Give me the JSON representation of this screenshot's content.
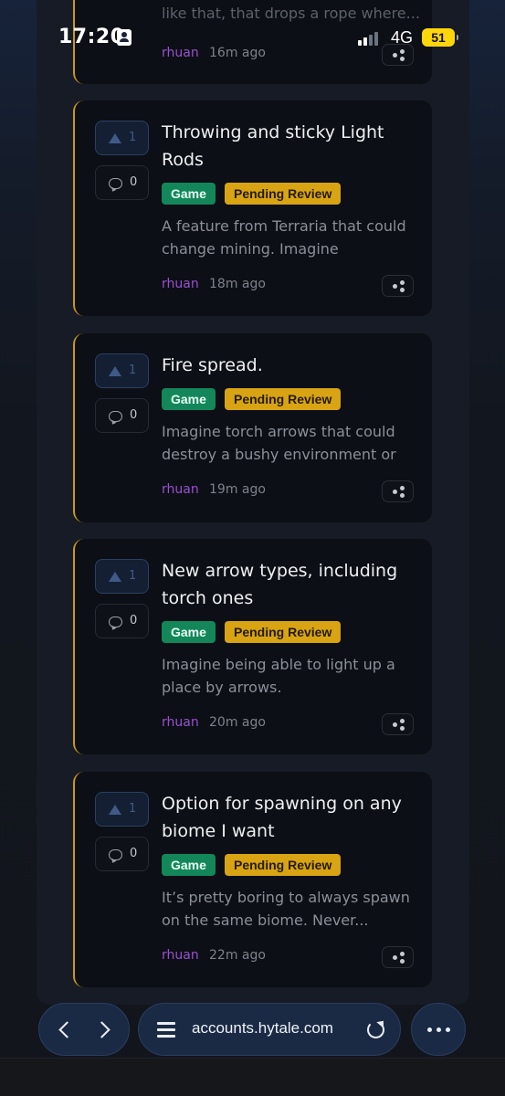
{
  "status_bar": {
    "time": "17:20",
    "network": "4G",
    "battery": "51",
    "accent_color": "#ffd60a"
  },
  "partial_post": {
    "desc_line_1": "like that, that drops a rope where...",
    "author": "rhuan",
    "time": "16m ago"
  },
  "posts": [
    {
      "votes": "1",
      "comments": "0",
      "title": "Throwing and sticky Light Rods",
      "tags": [
        "Game",
        "Pending Review"
      ],
      "description": "A feature from Terraria that could change mining. Imagine different...",
      "author": "rhuan",
      "time": "18m ago"
    },
    {
      "votes": "1",
      "comments": "0",
      "title": "Fire spread.",
      "tags": [
        "Game",
        "Pending Review"
      ],
      "description": "Imagine torch arrows that could destroy a bushy environment or a...",
      "author": "rhuan",
      "time": "19m ago"
    },
    {
      "votes": "1",
      "comments": "0",
      "title": "New arrow types, including torch ones",
      "tags": [
        "Game",
        "Pending Review"
      ],
      "description": "Imagine being able to light up a place by arrows.",
      "author": "rhuan",
      "time": "20m ago"
    },
    {
      "votes": "1",
      "comments": "0",
      "title": "Option for spawning on any biome I want",
      "tags": [
        "Game",
        "Pending Review"
      ],
      "description": "It’s pretty boring to always spawn on the same biome. Never...",
      "author": "rhuan",
      "time": "22m ago"
    }
  ],
  "colors": {
    "tag_game": "#13875a",
    "tag_pending": "#d8a414",
    "author": "#9b4fd1",
    "card_accent": "#c99a1c"
  },
  "browser": {
    "url": "accounts.hytale.com",
    "icons": [
      "back-icon",
      "forward-icon",
      "reader-icon",
      "reload-icon",
      "more-icon"
    ]
  }
}
